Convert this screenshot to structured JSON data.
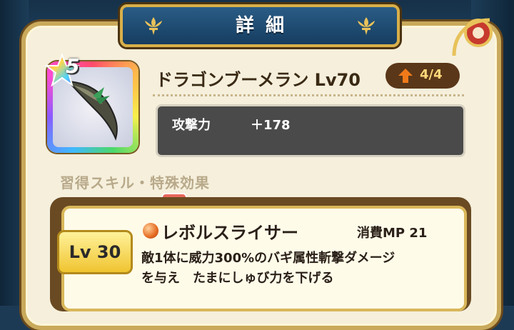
{
  "header": {
    "title": "詳細"
  },
  "item": {
    "name": "ドラゴンブーメラン Lv70",
    "rarity_stars": "5",
    "upgrade": "4/4",
    "stat": {
      "label": "攻撃力",
      "value": "＋178"
    }
  },
  "skills_section": {
    "title": "習得スキル・特殊効果",
    "skill": {
      "level": "Lv 30",
      "name": "レボルスライサー",
      "cost": "消費MP 21",
      "desc_line1": "敵1体に威力300%のバギ属性斬撃ダメージ",
      "desc_line2": "を与え　たまにしゅび力を下げる"
    }
  },
  "colors": {
    "frame_gold": "#c9a95b",
    "card_bg": "#f5efdc",
    "title_plate": "#2a5c86",
    "stat_box": "#4a4a4a",
    "level_pill": "#5a3718",
    "upgrade_arrow": "#f07a1a"
  },
  "icons": [
    "fleur-de-lis-icon",
    "star-icon",
    "boomerang-icon",
    "skill-orb-icon",
    "upgrade-arrow-icon"
  ]
}
